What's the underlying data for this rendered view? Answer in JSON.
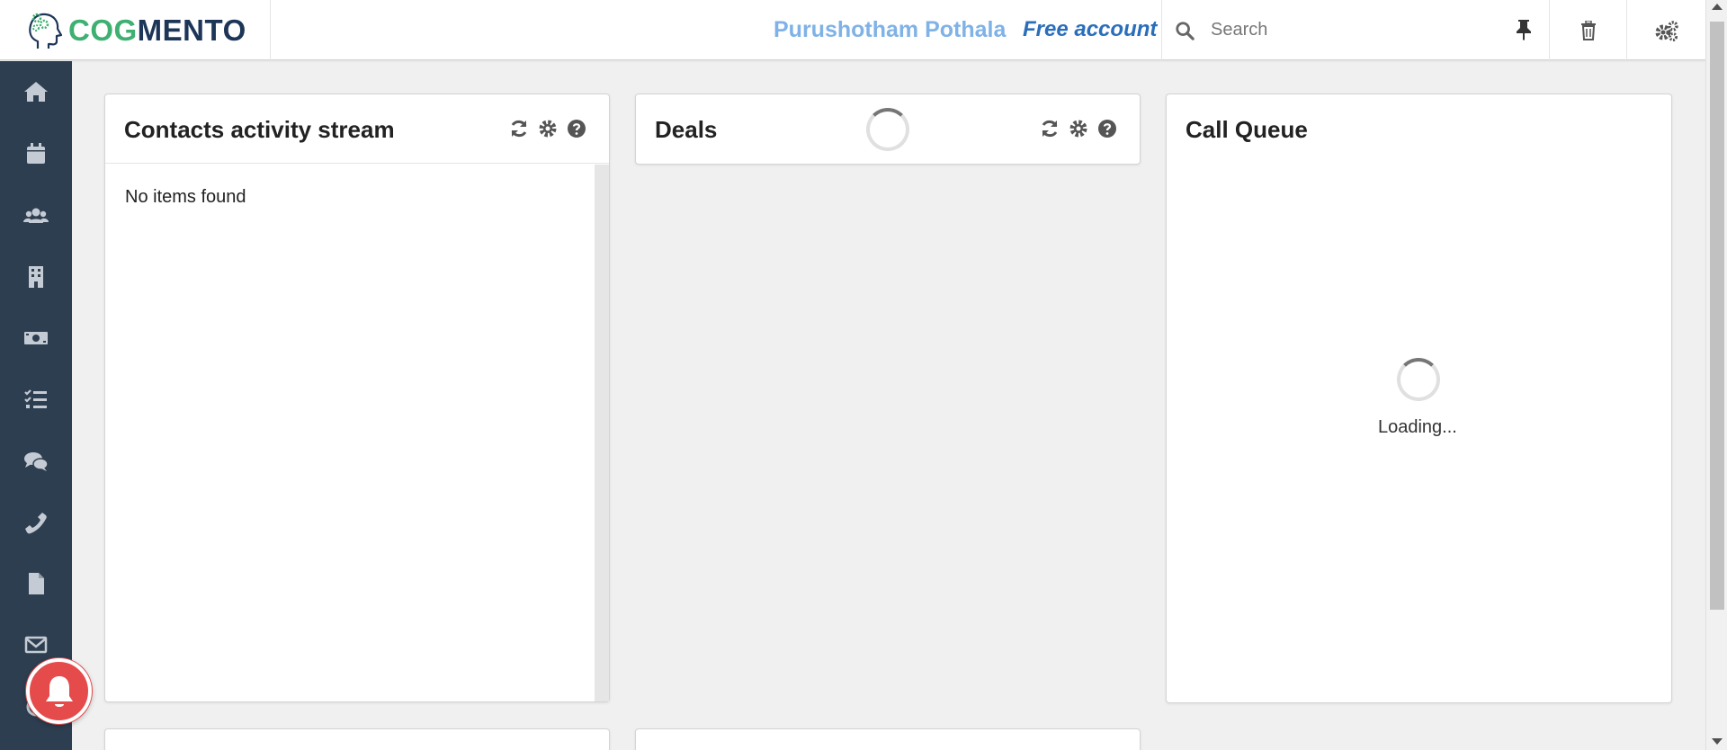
{
  "app": {
    "brand_part1": "COG",
    "brand_part2": "MENTO",
    "brand_colors": {
      "cog": "#3db072",
      "mento": "#1d3557"
    }
  },
  "header": {
    "user_name": "Purushotham Pothala",
    "account_type": "Free account",
    "search": {
      "placeholder": "Search",
      "value": ""
    },
    "icons": [
      "search-icon",
      "pin-icon",
      "trash-icon",
      "settings-icon"
    ]
  },
  "sidebar": {
    "items": [
      {
        "name": "home",
        "icon": "home-icon"
      },
      {
        "name": "calendar",
        "icon": "calendar-icon"
      },
      {
        "name": "contacts",
        "icon": "users-icon"
      },
      {
        "name": "companies",
        "icon": "building-icon"
      },
      {
        "name": "deals",
        "icon": "money-icon"
      },
      {
        "name": "tasks",
        "icon": "tasks-icon"
      },
      {
        "name": "cases",
        "icon": "comments-icon"
      },
      {
        "name": "calls",
        "icon": "phone-icon"
      },
      {
        "name": "documents",
        "icon": "file-icon"
      },
      {
        "name": "email",
        "icon": "envelope-icon"
      }
    ]
  },
  "cards": {
    "contacts_activity": {
      "title": "Contacts activity stream",
      "empty_text": "No items found"
    },
    "deals": {
      "title": "Deals"
    },
    "call_queue": {
      "title": "Call Queue",
      "loading_text": "Loading..."
    }
  },
  "colors": {
    "sidebar_bg": "#2d3e50",
    "user_name": "#7fb2e6",
    "account_type": "#2a6ebb",
    "notification": "#e54b4b"
  }
}
